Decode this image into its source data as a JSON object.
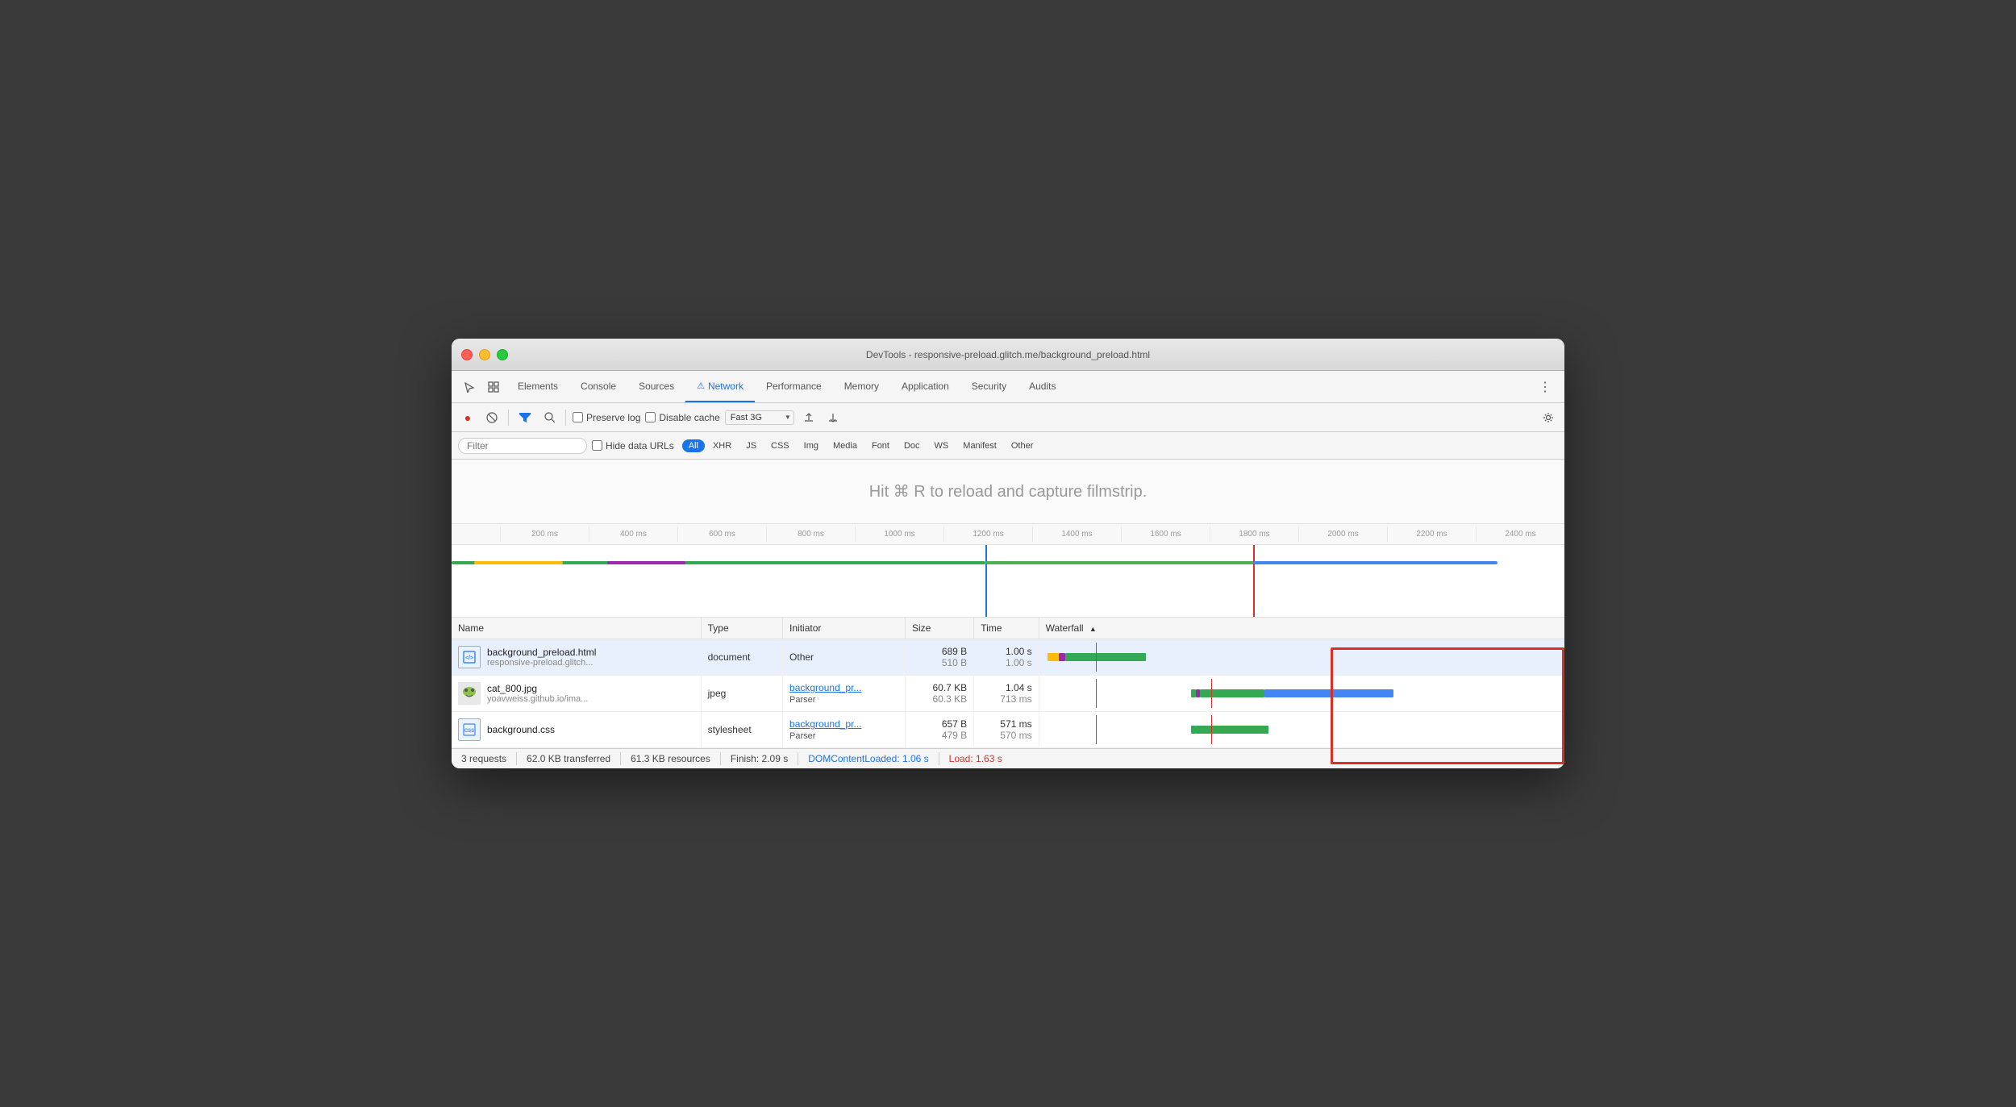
{
  "window": {
    "title": "DevTools - responsive-preload.glitch.me/background_preload.html"
  },
  "tabs": {
    "items": [
      {
        "label": "Elements",
        "active": false
      },
      {
        "label": "Console",
        "active": false
      },
      {
        "label": "Sources",
        "active": false
      },
      {
        "label": "Network",
        "active": true,
        "icon": "⚠"
      },
      {
        "label": "Performance",
        "active": false
      },
      {
        "label": "Memory",
        "active": false
      },
      {
        "label": "Application",
        "active": false
      },
      {
        "label": "Security",
        "active": false
      },
      {
        "label": "Audits",
        "active": false
      }
    ]
  },
  "toolbar": {
    "preserve_log": "Preserve log",
    "disable_cache": "Disable cache",
    "throttle": "Fast 3G"
  },
  "filter": {
    "placeholder": "Filter",
    "hide_data_urls": "Hide data URLs",
    "types": [
      "All",
      "XHR",
      "JS",
      "CSS",
      "Img",
      "Media",
      "Font",
      "Doc",
      "WS",
      "Manifest",
      "Other"
    ]
  },
  "filmstrip": {
    "hint": "Hit ⌘ R to reload and capture filmstrip."
  },
  "ruler": {
    "ticks": [
      "200 ms",
      "400 ms",
      "600 ms",
      "800 ms",
      "1000 ms",
      "1200 ms",
      "1400 ms",
      "1600 ms",
      "1800 ms",
      "2000 ms",
      "2200 ms",
      "2400 ms"
    ]
  },
  "table": {
    "headers": [
      "Name",
      "Type",
      "Initiator",
      "Size",
      "Time",
      "Waterfall"
    ],
    "rows": [
      {
        "name": "background_preload.html",
        "name_sub": "responsive-preload.glitch...",
        "type": "document",
        "initiator": "Other",
        "initiator_link": false,
        "size": "689 B",
        "size_sub": "510 B",
        "time": "1.00 s",
        "time_sub": "1.00 s",
        "icon_type": "html"
      },
      {
        "name": "cat_800.jpg",
        "name_sub": "yoavweiss.github.io/ima...",
        "type": "jpeg",
        "initiator": "background_pr...",
        "initiator_sub": "Parser",
        "initiator_link": true,
        "size": "60.7 KB",
        "size_sub": "60.3 KB",
        "time": "1.04 s",
        "time_sub": "713 ms",
        "icon_type": "img"
      },
      {
        "name": "background.css",
        "name_sub": "",
        "type": "stylesheet",
        "initiator": "background_pr...",
        "initiator_sub": "Parser",
        "initiator_link": true,
        "size": "657 B",
        "size_sub": "479 B",
        "time": "571 ms",
        "time_sub": "570 ms",
        "icon_type": "css"
      }
    ]
  },
  "status": {
    "requests": "3 requests",
    "transferred": "62.0 KB transferred",
    "resources": "61.3 KB resources",
    "finish": "Finish: 2.09 s",
    "dom_loaded_label": "DOMContentLoaded:",
    "dom_loaded_value": "1.06 s",
    "load_label": "Load:",
    "load_value": "1.63 s"
  }
}
